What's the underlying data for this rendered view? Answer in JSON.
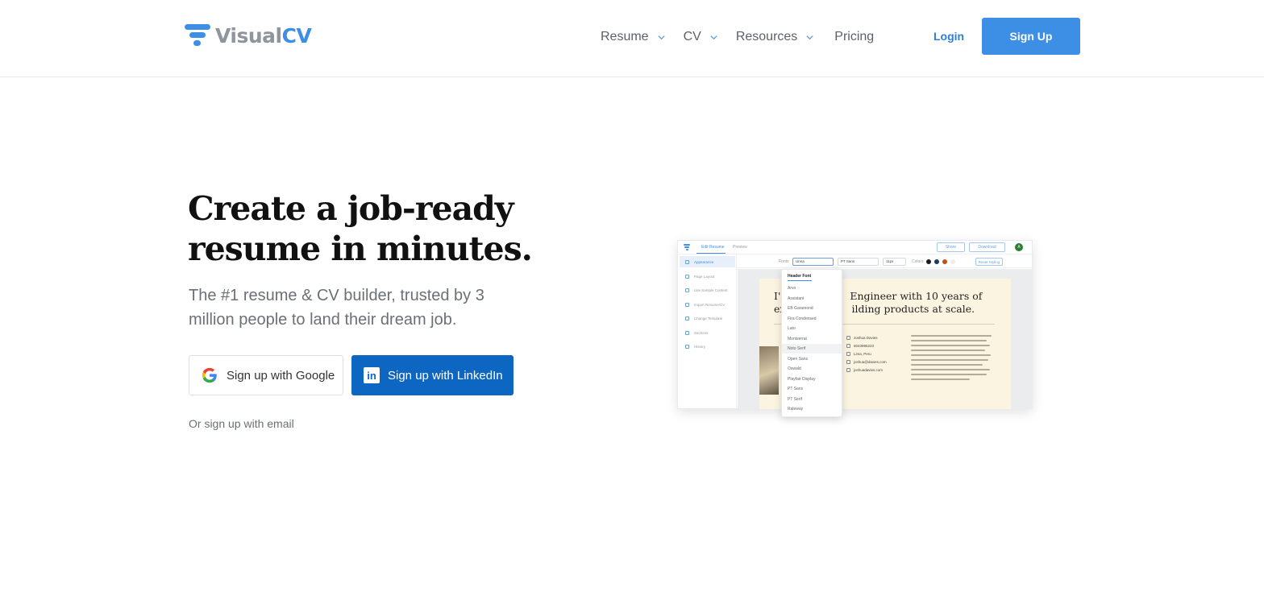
{
  "brand": {
    "name_part1": "Visual",
    "name_part2": "CV",
    "color": "#3d8fe6"
  },
  "nav": {
    "items": [
      {
        "label": "Resume",
        "has_dropdown": true
      },
      {
        "label": "CV",
        "has_dropdown": true
      },
      {
        "label": "Resources",
        "has_dropdown": true
      },
      {
        "label": "Pricing",
        "has_dropdown": false
      }
    ],
    "login_label": "Login",
    "signup_label": "Sign Up"
  },
  "hero": {
    "title": "Create a job-ready resume in minutes.",
    "subtitle": "The #1 resume & CV builder, trusted by 3 million people to land their dream job.",
    "google_button": "Sign up with Google",
    "linkedin_button": "Sign up with LinkedIn",
    "email_link": "Or sign up with email"
  },
  "preview": {
    "tabs": [
      "Edit Resume",
      "Preview"
    ],
    "share_label": "Share",
    "download_label": "Download",
    "avatar_initial": "A",
    "sidebar": [
      "Appearance",
      "Page Layout",
      "Use Sample Content",
      "Import Resume/CV",
      "Change Template",
      "Sections",
      "History"
    ],
    "toolbar": {
      "fonts_label": "Fonts",
      "header_font": "Unna",
      "body_font": "PT Sans",
      "size": "11px",
      "colors_label": "Colors",
      "colors": [
        "#1c1c1c",
        "#1f3b63",
        "#c0531b",
        "#f3ede0"
      ],
      "reset_label": "Reset Styling"
    },
    "dropdown": {
      "heading": "Header Font",
      "options": [
        "Arvo",
        "Assistant",
        "EB Garamond",
        "Fira Condensed",
        "Lato",
        "Montserrat",
        "Noto Serif",
        "Open Sans",
        "Oswald",
        "Playfair Display",
        "PT Sans",
        "PT Serif",
        "Raleway"
      ],
      "hovered": "Noto Serif"
    },
    "resume": {
      "headline_left_1": "I'",
      "headline_right_1": "Engineer with 10 years of",
      "headline_left_2": "ex",
      "headline_right_2": "ilding products at scale.",
      "contacts": [
        "Joshua Davies",
        "6043995223",
        "Lima, Peru",
        "joshua@davies.com",
        "joshuadavies.com"
      ]
    }
  }
}
